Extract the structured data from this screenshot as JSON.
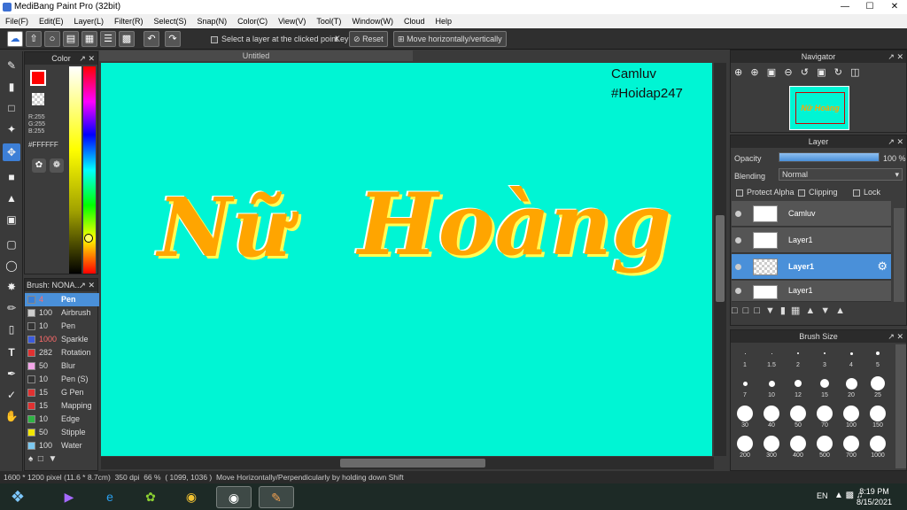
{
  "window": {
    "title": "MediBang Paint Pro (32bit)"
  },
  "menu": [
    "File(F)",
    "Edit(E)",
    "Layer(L)",
    "Filter(R)",
    "Select(S)",
    "Snap(N)",
    "Color(C)",
    "View(V)",
    "Tool(T)",
    "Window(W)",
    "Cloud",
    "Help"
  ],
  "toolbar": {
    "select_layer_label": "Select a layer at the clicked point",
    "key_label": "Key",
    "reset_label": "Reset",
    "move_label": "Move horizontally/vertically"
  },
  "color_panel": {
    "title": "Color",
    "r": "R:255",
    "g": "G:255",
    "b": "B:255",
    "hex": "#FFFFFF",
    "primary": "#ff0000",
    "secondary": "#ffffff"
  },
  "brush_panel": {
    "title": "Brush: NONA...",
    "items": [
      {
        "size": "4",
        "name": "Pen",
        "color": "#3b7fd6"
      },
      {
        "size": "100",
        "name": "Airbrush",
        "color": "#cccccc"
      },
      {
        "size": "10",
        "name": "Pen",
        "color": "#333333"
      },
      {
        "size": "1000",
        "name": "Sparkle",
        "color": "#3b5bdb"
      },
      {
        "size": "282",
        "name": "Rotation",
        "color": "#e03131"
      },
      {
        "size": "50",
        "name": "Blur",
        "color": "#f3a6e8"
      },
      {
        "size": "10",
        "name": "Pen (S)",
        "color": "#333333"
      },
      {
        "size": "15",
        "name": "G Pen",
        "color": "#e03131"
      },
      {
        "size": "15",
        "name": "Mapping",
        "color": "#e03131"
      },
      {
        "size": "10",
        "name": "Edge",
        "color": "#2fb344"
      },
      {
        "size": "50",
        "name": "Stipple",
        "color": "#f2e600"
      },
      {
        "size": "100",
        "name": "Water",
        "color": "#7cc8f0"
      }
    ]
  },
  "canvas": {
    "tab_title": "Untitled",
    "background": "#00f5d4",
    "watermark_line1": "Camluv",
    "watermark_line2": "#Hoidap247",
    "art_word1": "Nữ",
    "art_word2": "Hoàng"
  },
  "navigator": {
    "title": "Navigator"
  },
  "layer_panel": {
    "title": "Layer",
    "opacity_label": "Opacity",
    "opacity_value": "100 %",
    "opacity_fraction": 1.0,
    "blending_label": "Blending",
    "blending_value": "Normal",
    "protect_alpha": "Protect Alpha",
    "clipping": "Clipping",
    "lock": "Lock",
    "layers": [
      {
        "name": "Camluv"
      },
      {
        "name": "Layer1"
      },
      {
        "name": "Layer1"
      },
      {
        "name": "Layer1"
      }
    ]
  },
  "brush_size": {
    "title": "Brush Size",
    "sizes": [
      "1",
      "1.5",
      "2",
      "3",
      "4",
      "5",
      "7",
      "10",
      "12",
      "15",
      "20",
      "25",
      "30",
      "40",
      "50",
      "70",
      "100",
      "150",
      "200",
      "300",
      "400",
      "500",
      "700",
      "1000"
    ]
  },
  "status": {
    "dims": "1600 * 1200 pixel",
    "physical": "(11.6 * 8.7cm)",
    "dpi": "350 dpi",
    "zoom": "66 %",
    "cursor": "( 1099, 1036 )",
    "hint": "Move Horizontally/Perpendicularly by holding down Shift"
  },
  "taskbar": {
    "lang": "EN",
    "time": "8:19 PM",
    "date": "8/15/2021"
  }
}
